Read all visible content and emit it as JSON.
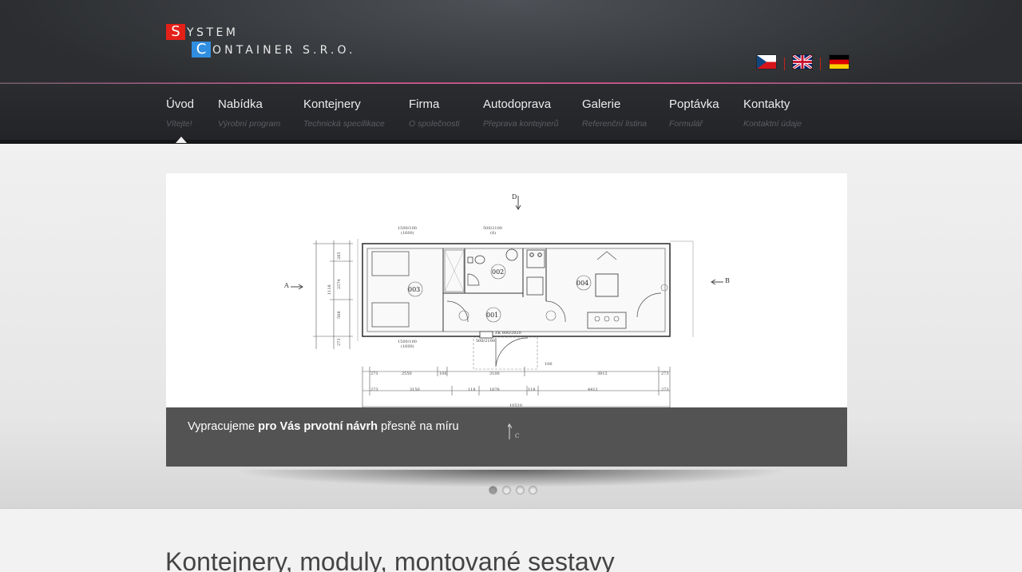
{
  "logo": {
    "initial_1": "S",
    "rest_1": "YSTEM",
    "initial_2": "C",
    "rest_2": "ONTAINER S.R.O."
  },
  "languages": [
    {
      "code": "cz",
      "icon": "czech-flag-icon"
    },
    {
      "code": "en",
      "icon": "uk-flag-icon"
    },
    {
      "code": "de",
      "icon": "german-flag-icon"
    }
  ],
  "nav": {
    "items": [
      {
        "label": "Úvod",
        "sublabel": "Vítejte!",
        "active": true
      },
      {
        "label": "Nabídka",
        "sublabel": "Výrobní program"
      },
      {
        "label": "Kontejnery",
        "sublabel": "Technická specifikace"
      },
      {
        "label": "Firma",
        "sublabel": "O společnosti"
      },
      {
        "label": "Autodoprava",
        "sublabel": "Přeprava kontejnerů"
      },
      {
        "label": "Galerie",
        "sublabel": "Referenční listina"
      },
      {
        "label": "Poptávka",
        "sublabel": "Formulář"
      },
      {
        "label": "Kontakty",
        "sublabel": "Kontaktní údaje"
      }
    ]
  },
  "slider": {
    "caption_prefix": "Vypracujeme ",
    "caption_bold": "pro Vás prvotní návrh",
    "caption_suffix": " přesně na míru",
    "caption_overlay_mark": "C",
    "dots": 4,
    "active_dot": 1,
    "plan": {
      "marker_d": "D",
      "marker_a": "A",
      "marker_b": "B",
      "room_1": "001",
      "room_2": "002",
      "room_3": "003",
      "room_4": "004",
      "dim_top_left": "1500/100",
      "dim_top_left_b": "(1600)",
      "dim_top_mid": "500/2100",
      "dim_top_mid_b": "(8)",
      "dim_bottom_left": "1500/100",
      "dim_bottom_left_b": "(1600)",
      "dim_door": "500/2100",
      "dim_door_label": "ZK 800/2020",
      "dims_row_1": [
        "273",
        "2550",
        "106",
        "3100",
        "3812",
        "273"
      ],
      "dims_row_2": [
        "273",
        "3150",
        "118",
        "1876",
        "118",
        "4412",
        "273"
      ],
      "dim_total": "10520",
      "dim_106": "106",
      "dims_left": [
        "285",
        "2574",
        "1118",
        "568",
        "273"
      ]
    }
  },
  "content": {
    "heading": "Kontejnery, moduly, montované sestavy"
  },
  "colors": {
    "logo_red": "#e32119",
    "logo_blue": "#2f8ee0",
    "accent_line": "#c64a84",
    "nav_bg": "#26282b"
  }
}
